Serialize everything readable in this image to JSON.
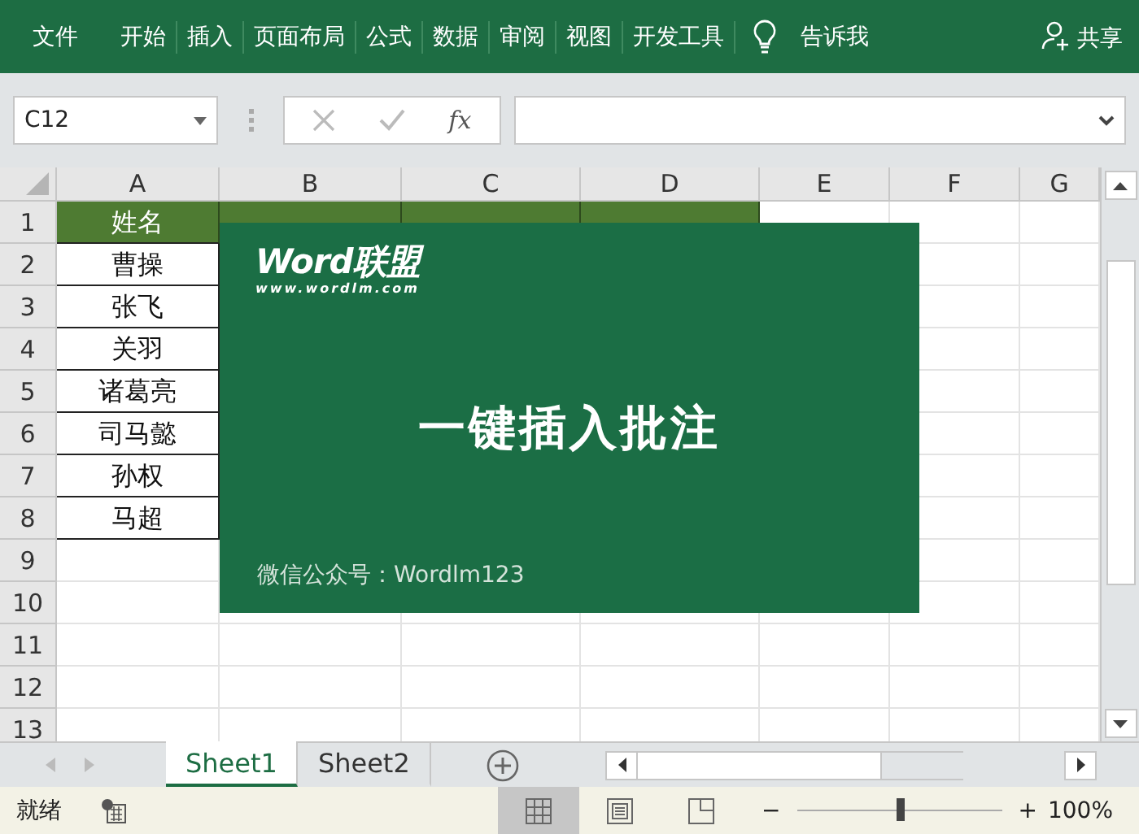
{
  "ribbon": {
    "tabs": [
      {
        "label": "文件"
      },
      {
        "label": "开始"
      },
      {
        "label": "插入"
      },
      {
        "label": "页面布局"
      },
      {
        "label": "公式"
      },
      {
        "label": "数据"
      },
      {
        "label": "审阅"
      },
      {
        "label": "视图"
      },
      {
        "label": "开发工具"
      }
    ],
    "tell_me": "告诉我",
    "share": "共享"
  },
  "formula_bar": {
    "name_box": "C12",
    "fx": "fx"
  },
  "sheet": {
    "columns": [
      "A",
      "B",
      "C",
      "D",
      "E",
      "F",
      "G"
    ],
    "row_numbers": [
      "1",
      "2",
      "3",
      "4",
      "5",
      "6",
      "7",
      "8",
      "9",
      "10",
      "11",
      "12",
      "13"
    ],
    "rows": [
      {
        "cells": [
          "姓名"
        ],
        "kind": "header",
        "filled": [
          true,
          true,
          true,
          true,
          false,
          false,
          false
        ]
      },
      {
        "cells": [
          "曹操"
        ],
        "kind": "data"
      },
      {
        "cells": [
          "张飞"
        ],
        "kind": "data"
      },
      {
        "cells": [
          "关羽"
        ],
        "kind": "data"
      },
      {
        "cells": [
          "诸葛亮"
        ],
        "kind": "data"
      },
      {
        "cells": [
          "司马懿"
        ],
        "kind": "data"
      },
      {
        "cells": [
          "孙权"
        ],
        "kind": "data"
      },
      {
        "cells": [
          "马超"
        ],
        "kind": "data"
      }
    ]
  },
  "overlay": {
    "logo": "Word联盟",
    "site": "www.wordlm.com",
    "title": "一键插入批注",
    "footer": "微信公众号：Wordlm123"
  },
  "sheet_tabs": [
    {
      "label": "Sheet1",
      "selected": true
    },
    {
      "label": "Sheet2",
      "selected": false
    }
  ],
  "status_bar": {
    "status": "就绪",
    "zoom": "100%",
    "zoom_out": "−",
    "zoom_in": "+",
    "zoom_slider": {
      "level": 0.5
    },
    "views": [
      {
        "kind": "normal",
        "selected": true
      },
      {
        "kind": "page_layout",
        "selected": false
      },
      {
        "kind": "page_break",
        "selected": false
      }
    ]
  }
}
